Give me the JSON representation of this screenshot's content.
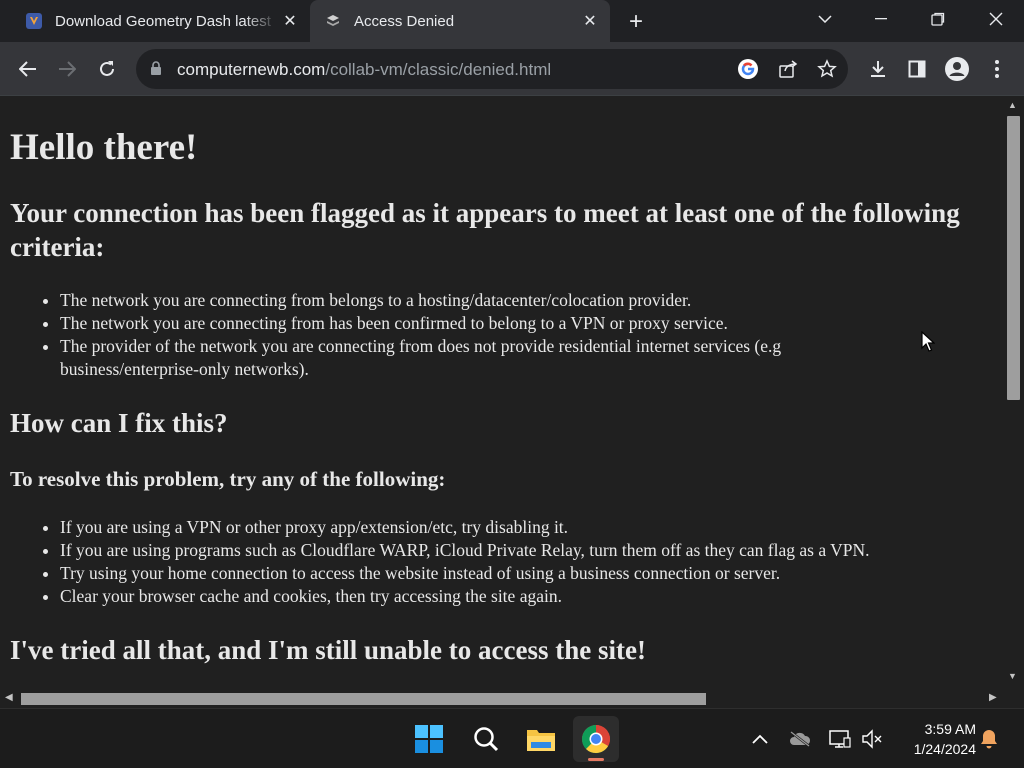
{
  "browser": {
    "tabs": [
      {
        "title": "Download Geometry Dash latest",
        "active": false
      },
      {
        "title": "Access Denied",
        "active": true
      }
    ],
    "url_host": "computernewb.com",
    "url_path": "/collab-vm/classic/denied.html"
  },
  "page": {
    "heading": "Hello there!",
    "flag_heading": "Your connection has been flagged as it appears to meet at least one of the following criteria:",
    "criteria": [
      "The network you are connecting from belongs to a hosting/datacenter/colocation provider.",
      "The network you are connecting from has been confirmed to belong to a VPN or proxy service.",
      "The provider of the network you are connecting from does not provide residential internet services (e.g business/enterprise-only networks)."
    ],
    "fix_heading": "How can I fix this?",
    "resolve_heading": "To resolve this problem, try any of the following:",
    "fixes": [
      "If you are using a VPN or other proxy app/extension/etc, try disabling it.",
      "If you are using programs such as Cloudflare WARP, iCloud Private Relay, turn them off as they can flag as a VPN.",
      "Try using your home connection to access the website instead of using a business connection or server.",
      "Clear your browser cache and cookies, then try accessing the site again."
    ],
    "still_heading": "I've tried all that, and I'm still unable to access the site!"
  },
  "taskbar": {
    "time": "3:59 AM",
    "date": "1/24/2024"
  },
  "colors": {
    "accent": "#e67a63",
    "tab_active": "#35363a",
    "page_bg": "#202020"
  }
}
